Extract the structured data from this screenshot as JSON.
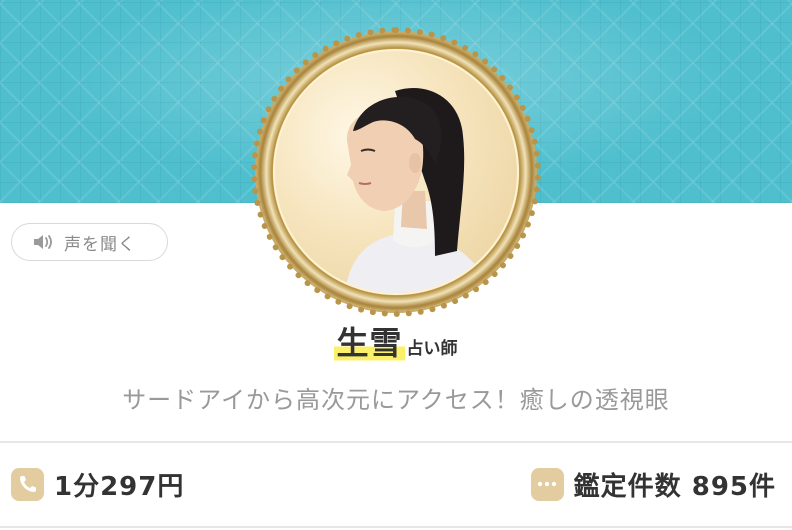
{
  "profile": {
    "name": "生雪",
    "title_suffix": "占い師",
    "tagline": "サードアイから高次元にアクセス！癒しの透視眼"
  },
  "voice_button": {
    "label": "声を聞く",
    "icon": "speaker-icon"
  },
  "stats": {
    "price": "1分297円",
    "price_icon": "phone-icon",
    "count": "鑑定件数 895件",
    "count_icon": "chat-bubble-icon"
  },
  "colors": {
    "banner": "#4fbfce",
    "highlight": "#fbf06a",
    "badge": "#e3cda0",
    "frame_gold": "#b8954a"
  }
}
